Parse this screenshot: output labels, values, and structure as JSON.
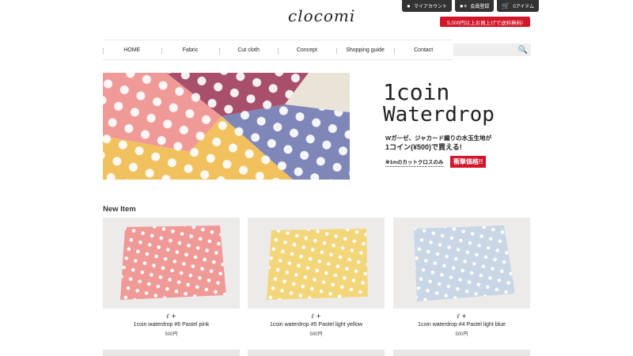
{
  "header": {
    "logo": "clocomi",
    "account_label": "マイアカウント",
    "register_label": "会員登録",
    "cart_label": "0アイテム",
    "free_shipping": "5,000円以上お買上げで送料無料!"
  },
  "nav": {
    "items": [
      "HOME",
      "Fabric",
      "Cut cloth",
      "Concept",
      "Shopping guide",
      "Contact"
    ]
  },
  "hero": {
    "title_line1": "1coin",
    "title_line2": "Waterdrop",
    "sub_line1": "Wガーゼ、ジャカード織りの水玉生地が",
    "sub_line2": "1コイン(¥500)で買える!",
    "note": "※1mのカットクロスのみ",
    "badge": "衝撃価格!!"
  },
  "new_items": {
    "title": "New Item",
    "products": [
      {
        "mark": "ℓ +",
        "name": "1coin waterdrop #6 Pastel pink",
        "price": "500円",
        "color": "#f09a98"
      },
      {
        "mark": "ℓ +",
        "name": "1coin waterdrop #5 Pastel light yellow",
        "price": "500円",
        "color": "#f4d67a"
      },
      {
        "mark": "ℓ +",
        "name": "1coin waterdrop #4 Pastel light blue",
        "price": "500円",
        "color": "#c9d6e6"
      }
    ]
  },
  "colors": {
    "accent_red": "#d3162a",
    "dark": "#333333"
  }
}
